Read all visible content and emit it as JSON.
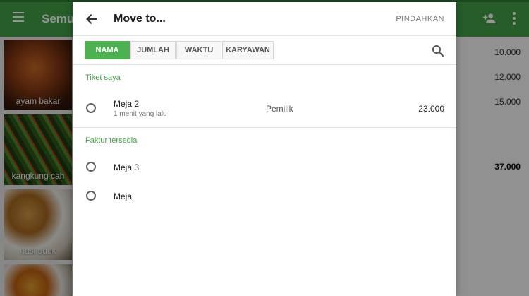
{
  "background": {
    "title": "Semua",
    "tiles": [
      "ayam bakar",
      "kangkung cah",
      "nasi uduk",
      ""
    ],
    "prices": [
      "10.000",
      "12.000",
      "15.000"
    ],
    "total": "37.000"
  },
  "dialog": {
    "title": "Move to...",
    "action_label": "PINDAHKAN",
    "filters": [
      "NAMA",
      "JUMLAH",
      "WAKTU",
      "KARYAWAN"
    ],
    "active_filter": "NAMA",
    "my_tickets": {
      "label": "Tiket saya",
      "items": [
        {
          "name": "Meja 2",
          "time": "1 menit yang lalu",
          "owner": "Pemilik",
          "amount": "23.000"
        }
      ]
    },
    "available": {
      "label": "Faktur tersedia",
      "items": [
        {
          "name": "Meja 3"
        },
        {
          "name": "Meja"
        }
      ]
    }
  },
  "colors": {
    "brand_green": "#43a047",
    "active_tab": "#4caf50"
  }
}
